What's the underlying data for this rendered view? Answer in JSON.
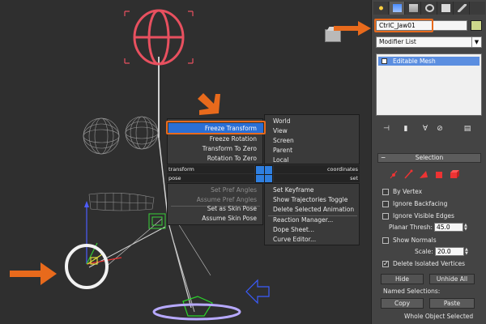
{
  "quad_menu": {
    "left_top": {
      "items": [
        "Freeze Transform",
        "Freeze Rotation",
        "Transform To Zero",
        "Rotation To Zero"
      ],
      "selected": "Freeze Transform"
    },
    "left_header_labels": [
      "transform",
      "pose"
    ],
    "left_bottom": {
      "items_disabled": [
        "Set Pref Angles",
        "Assume Pref Angles"
      ],
      "items": [
        "Set as Skin Pose",
        "Assume Skin Pose"
      ]
    },
    "right_top": {
      "items": [
        "World",
        "View",
        "Screen",
        "Parent",
        "Local"
      ]
    },
    "right_header_labels": [
      "coordinates",
      "set"
    ],
    "right_bottom": {
      "group1": [
        "Set Keyframe",
        "Show Trajectories Toggle",
        "Delete Selected Animation"
      ],
      "group2": [
        "Reaction Manager...",
        "Dope Sheet...",
        "Curve Editor..."
      ]
    }
  },
  "command_panel": {
    "object_name": "CtrlC_Jaw01",
    "object_color": "#cdd78b",
    "modifier_list_label": "Modifier List",
    "stack_item": "Editable Mesh",
    "tabs": [
      "create-icon",
      "modify-icon",
      "hierarchy-icon",
      "motion-icon",
      "display-icon",
      "utilities-icon"
    ],
    "selection_rollout": {
      "title": "Selection",
      "by_vertex": "By Vertex",
      "ignore_backfacing": "Ignore Backfacing",
      "ignore_visible_edges": "Ignore Visible Edges",
      "planar_thresh_label": "Planar Thresh:",
      "planar_thresh_value": "45.0",
      "show_normals": "Show Normals",
      "scale_label": "Scale:",
      "scale_value": "20.0",
      "delete_isolated": "Delete Isolated Vertices",
      "hide": "Hide",
      "unhide_all": "Unhide All",
      "named_selections": "Named Selections:",
      "copy": "Copy",
      "paste": "Paste",
      "status": "Whole Object Selected"
    }
  },
  "colors": {
    "callout": "#e86a1c",
    "highlight": "#2a6fd6",
    "rig_red": "#e8505f",
    "rig_white": "#f2f2f2",
    "rig_blue": "#4d5cff"
  }
}
